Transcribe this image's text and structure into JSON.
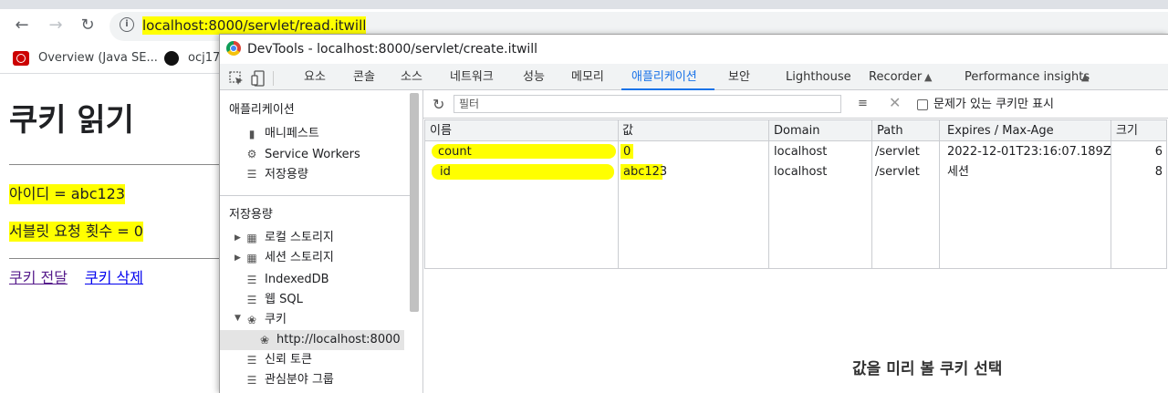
{
  "browser": {
    "url": "localhost:8000/servlet/read.itwill",
    "bookmarks": [
      {
        "label": "Overview (Java SE..."
      },
      {
        "label": "ocj17"
      }
    ]
  },
  "page": {
    "title": "쿠키 읽기",
    "id_line": "아이디 = abc123",
    "count_line": "서블릿 요청 횟수 = 0",
    "links": [
      "쿠키 전달",
      "쿠키 삭제"
    ]
  },
  "devtools": {
    "title": "DevTools - localhost:8000/servlet/create.itwill",
    "tabs": [
      "요소",
      "콘솔",
      "소스",
      "네트워크",
      "성능",
      "메모리",
      "애플리케이션",
      "보안",
      "Lighthouse",
      "Recorder",
      "Performance insights"
    ],
    "active_tab": "애플리케이션",
    "sidebar": {
      "app_section": "애플리케이션",
      "app_items": [
        "매니페스트",
        "Service Workers",
        "저장용량"
      ],
      "storage_section": "저장용량",
      "storage_items": [
        "로컬 스토리지",
        "세션 스토리지",
        "IndexedDB",
        "웹 SQL",
        "쿠키",
        "http://localhost:8000",
        "신뢰 토큰",
        "관심분야 그룹"
      ]
    },
    "filter_placeholder": "필터",
    "only_issues_label": "문제가 있는 쿠키만 표시",
    "columns": [
      "이름",
      "값",
      "Domain",
      "Path",
      "Expires / Max-Age",
      "크기"
    ],
    "cookies": [
      {
        "name": "count",
        "value": "0",
        "domain": "localhost",
        "path": "/servlet",
        "expires": "2022-12-01T23:16:07.189Z",
        "size": "6"
      },
      {
        "name": "id",
        "value": "abc123",
        "domain": "localhost",
        "path": "/servlet",
        "expires": "세션",
        "size": "8"
      }
    ],
    "preview_hint": "값을 미리 볼 쿠키 선택"
  },
  "colors": {
    "highlight": "#ffff00",
    "accent": "#1a73e8"
  }
}
